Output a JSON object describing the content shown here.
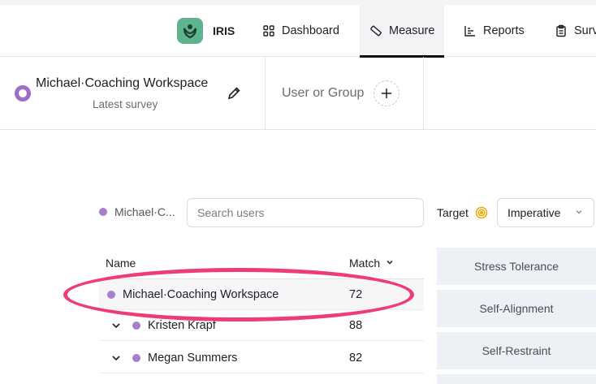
{
  "app": {
    "name": "IRIS",
    "brand_color": "#5fb38e"
  },
  "nav": [
    {
      "label": "Dashboard",
      "icon": "grid-icon"
    },
    {
      "label": "Measure",
      "icon": "ruler-icon",
      "active": true
    },
    {
      "label": "Reports",
      "icon": "bar-chart-icon"
    },
    {
      "label": "Surv",
      "icon": "clipboard-icon"
    }
  ],
  "workspace": {
    "title": "Michael·Coaching Workspace",
    "subtitle": "Latest survey",
    "ring_color": "#9d6fc6"
  },
  "user_group": {
    "label": "User or Group"
  },
  "filter": {
    "chip_label": "Michael·C...",
    "search_placeholder": "Search users",
    "target_label": "Target",
    "target_value": "Imperative"
  },
  "table": {
    "col_name": "Name",
    "col_match": "Match",
    "rows": [
      {
        "name": "Michael·Coaching Workspace",
        "match": "72"
      },
      {
        "name": "Kristen Krapf",
        "match": "88"
      },
      {
        "name": "Megan Summers",
        "match": "82"
      }
    ]
  },
  "traits": [
    "Stress Tolerance",
    "Self-Alignment",
    "Self-Restraint"
  ],
  "annotation_color": "#ee3c74"
}
